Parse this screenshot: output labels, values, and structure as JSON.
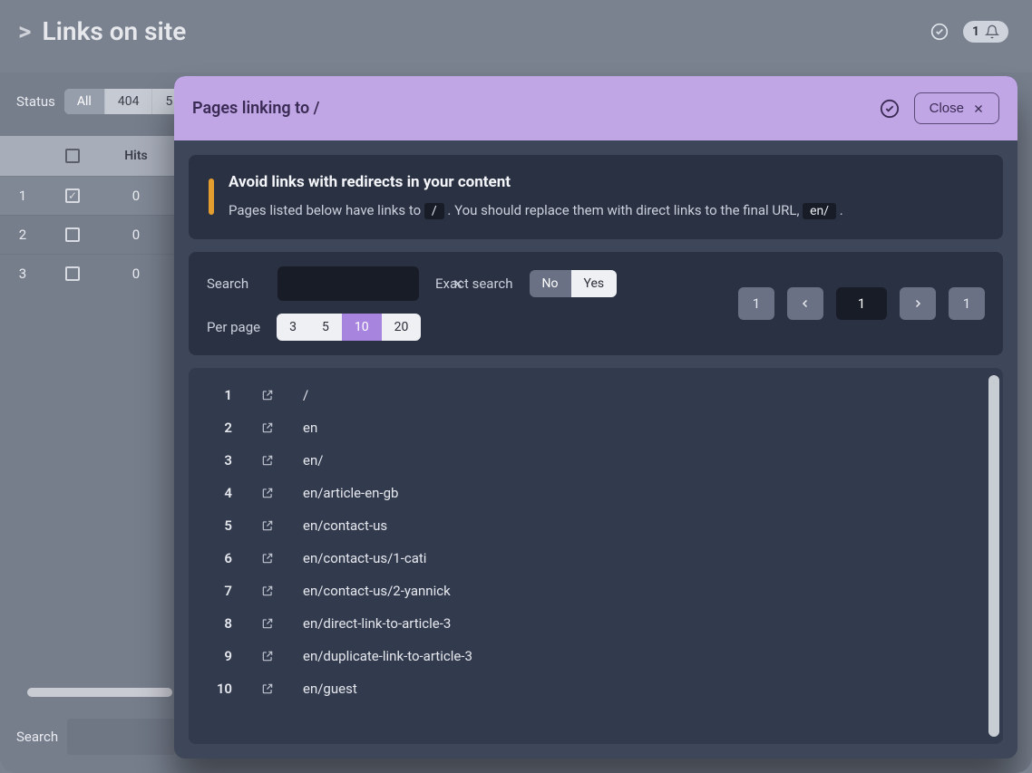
{
  "header": {
    "breadcrumb_prefix": ">",
    "title": "Links on site",
    "notif_count": "1"
  },
  "bg": {
    "status_label": "Status",
    "tabs": [
      "All",
      "404",
      "5"
    ],
    "thead_hits": "Hits",
    "rows": [
      {
        "n": "1",
        "hits": "0",
        "checked": true
      },
      {
        "n": "2",
        "hits": "0",
        "checked": false
      },
      {
        "n": "3",
        "hits": "0",
        "checked": false
      }
    ],
    "search_label": "Search"
  },
  "modal": {
    "title": "Pages linking to /",
    "close_label": "Close",
    "alert": {
      "title": "Avoid links with redirects in your content",
      "text_prefix": "Pages listed below have links to ",
      "chip1": "/",
      "text_mid": ". You should replace them with direct links to the final URL, ",
      "chip2": "en/",
      "text_suffix": "."
    },
    "filters": {
      "search_label": "Search",
      "search_value": "",
      "exact_label": "Exact search",
      "exact_no": "No",
      "exact_yes": "Yes",
      "perpage_label": "Per page",
      "perpage_options": [
        "3",
        "5",
        "10",
        "20"
      ],
      "perpage_selected": "10"
    },
    "pager": {
      "first": "1",
      "current": "1",
      "last": "1"
    },
    "list": [
      {
        "n": "1",
        "url": "/"
      },
      {
        "n": "2",
        "url": "en"
      },
      {
        "n": "3",
        "url": "en/"
      },
      {
        "n": "4",
        "url": "en/article-en-gb"
      },
      {
        "n": "5",
        "url": "en/contact-us"
      },
      {
        "n": "6",
        "url": "en/contact-us/1-cati"
      },
      {
        "n": "7",
        "url": "en/contact-us/2-yannick"
      },
      {
        "n": "8",
        "url": "en/direct-link-to-article-3"
      },
      {
        "n": "9",
        "url": "en/duplicate-link-to-article-3"
      },
      {
        "n": "10",
        "url": "en/guest"
      }
    ]
  }
}
